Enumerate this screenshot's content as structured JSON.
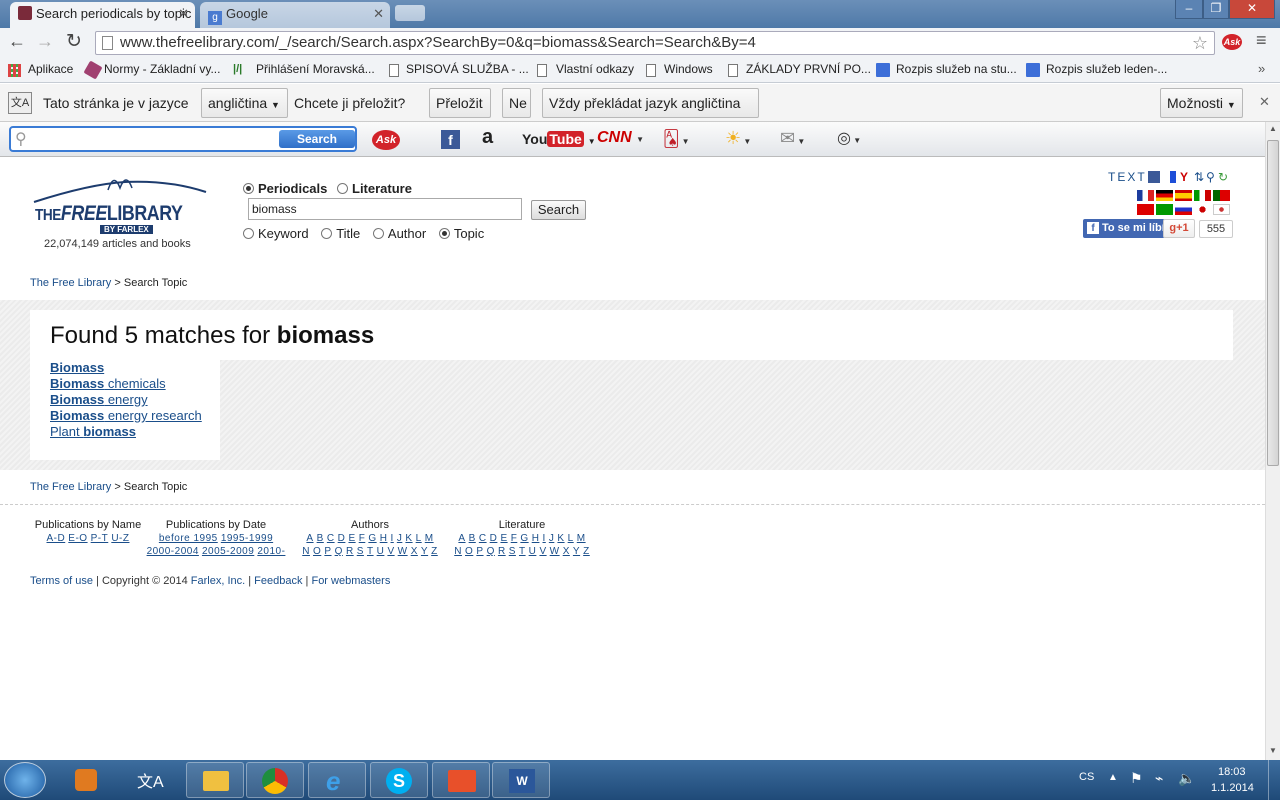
{
  "browser": {
    "tabs": [
      {
        "title": "Search periodicals by topic",
        "active": true
      },
      {
        "title": "Google",
        "active": false
      }
    ],
    "url": "www.thefreelibrary.com/_/search/Search.aspx?SearchBy=0&q=biomass&Search=Search&By=4",
    "bookmarks": [
      "Aplikace",
      "Normy - Základní vy...",
      "Přihlášení  Moravská...",
      "SPISOVÁ SLUŽBA - ...",
      "Vlastní odkazy",
      "Windows",
      "ZÁKLADY PRVNÍ PO...",
      "Rozpis služeb na stu...",
      "Rozpis služeb leden-..."
    ]
  },
  "translate_bar": {
    "prompt": "Tato stránka je v jazyce",
    "language": "angličtina",
    "question": "Chcete ji přeložit?",
    "translate_button": "Přeložit",
    "no_button": "Ne",
    "always_button": "Vždy překládat jazyk angličtina",
    "options_button": "Možnosti"
  },
  "ask_toolbar": {
    "search_button": "Search",
    "ask_label": "Ask",
    "youtube_label": "YouTube",
    "cnn_label": "CNN"
  },
  "site": {
    "logo_line1": "THE",
    "logo_line2": "FREE",
    "logo_line3": "LIBRARY",
    "logo_sub": "BY FARLEX",
    "article_count": "22,074,149 articles and books",
    "search": {
      "scope_options": [
        "Periodicals",
        "Literature"
      ],
      "scope_selected": "Periodicals",
      "query": "biomass",
      "search_button": "Search",
      "by_options": [
        "Keyword",
        "Title",
        "Author",
        "Topic"
      ],
      "by_selected": "Topic"
    },
    "text_link": "TEXT",
    "fb_button": "To se mi líbí",
    "gplus_label": "g+1",
    "gplus_count": "555",
    "breadcrumb_home": "The Free Library",
    "breadcrumb_sep": ">",
    "breadcrumb_current": "Search Topic",
    "results_heading_prefix": "Found 5 matches for",
    "results_heading_term": "biomass",
    "results": [
      {
        "term": "Biomass",
        "rest": ""
      },
      {
        "term": "Biomass",
        "rest": " chemicals"
      },
      {
        "term": "Biomass",
        "rest": " energy"
      },
      {
        "term": "Biomass",
        "rest": " energy research"
      },
      {
        "term": "Plant ",
        "rest": "biomass",
        "bold_second": true
      }
    ],
    "footer": {
      "pub_by_name_title": "Publications by Name",
      "pub_by_name_links": [
        "A-D",
        "E-O",
        "P-T",
        "U-Z"
      ],
      "pub_by_date_title": "Publications by Date",
      "pub_by_date_links_row1": [
        "before 1995",
        "1995-1999"
      ],
      "pub_by_date_links_row2": [
        "2000-2004",
        "2005-2009",
        "2010-"
      ],
      "authors_title": "Authors",
      "literature_title": "Literature",
      "alpha_row1": [
        "A",
        "B",
        "C",
        "D",
        "E",
        "F",
        "G",
        "H",
        "I",
        "J",
        "K",
        "L",
        "M"
      ],
      "alpha_row2": [
        "N",
        "O",
        "P",
        "Q",
        "R",
        "S",
        "T",
        "U",
        "V",
        "W",
        "X",
        "Y",
        "Z"
      ],
      "terms": "Terms of use",
      "copyright": "Copyright © 2014",
      "farlex": "Farlex, Inc.",
      "feedback": "Feedback",
      "webmasters": "For webmasters"
    }
  },
  "taskbar": {
    "lang": "CS",
    "time": "18:03",
    "date": "1.1.2014"
  }
}
